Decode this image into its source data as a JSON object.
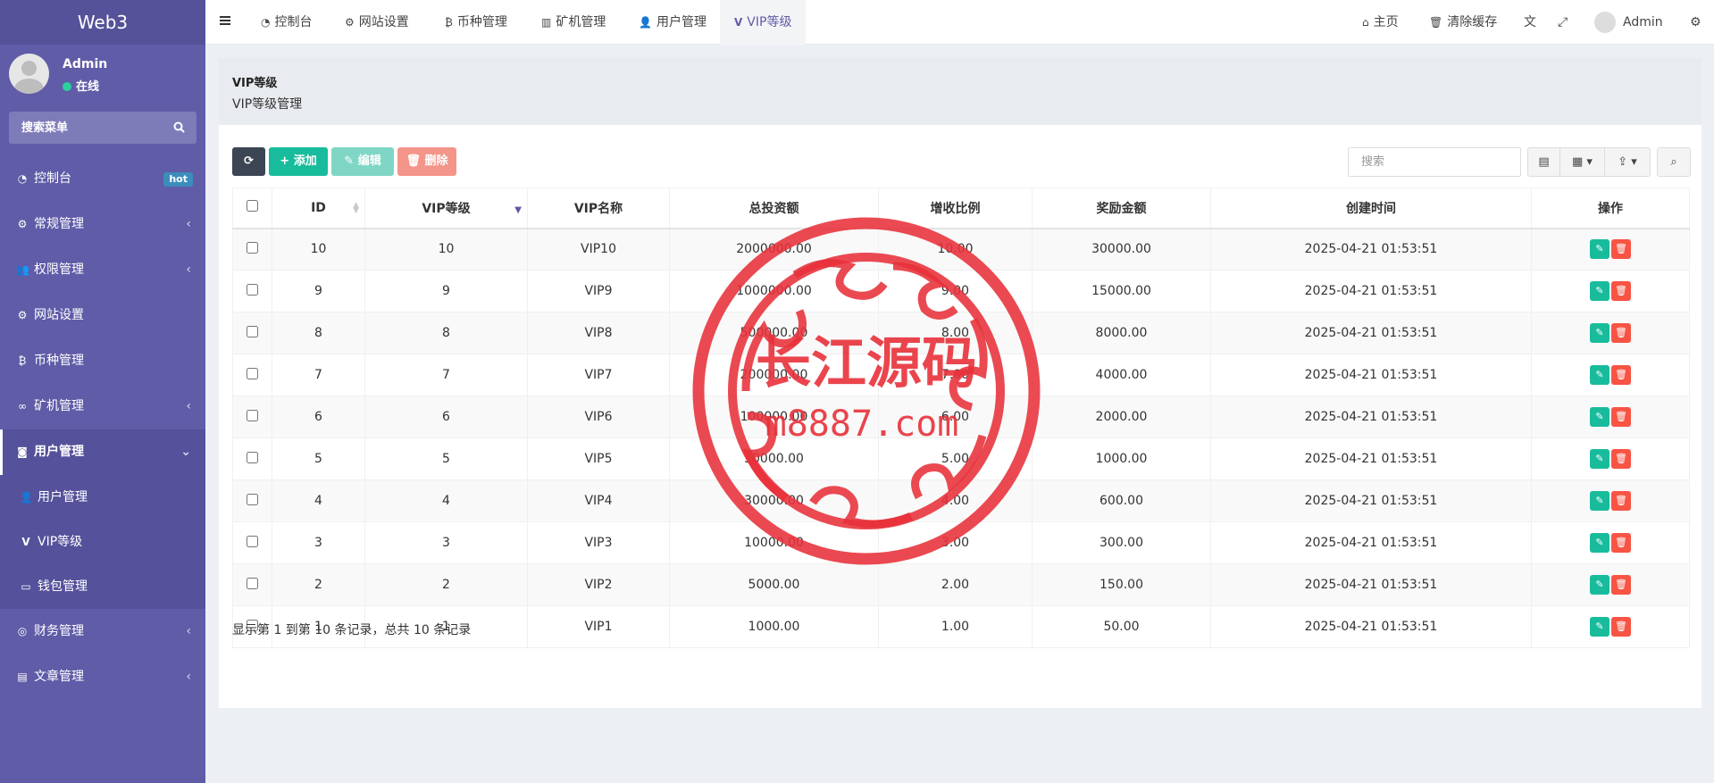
{
  "sidebar": {
    "logo": "Web3",
    "user": {
      "name": "Admin",
      "status": "在线"
    },
    "search_placeholder": "搜索菜单",
    "items": [
      {
        "label": "控制台",
        "icon": "dashboard-icon",
        "badge": "hot"
      },
      {
        "label": "常规管理",
        "icon": "cogs-icon",
        "arrow": "‹"
      },
      {
        "label": "权限管理",
        "icon": "group-icon",
        "arrow": "‹"
      },
      {
        "label": "网站设置",
        "icon": "cogs-icon"
      },
      {
        "label": "币种管理",
        "icon": "bitcoin-icon"
      },
      {
        "label": "矿机管理",
        "icon": "binoculars-icon",
        "arrow": "‹"
      },
      {
        "label": "用户管理",
        "icon": "instagram-icon",
        "arrow": "⌄"
      },
      {
        "label": "财务管理",
        "icon": "money-icon",
        "arrow": "‹"
      },
      {
        "label": "文章管理",
        "icon": "book-icon",
        "arrow": "‹"
      }
    ],
    "submenu": [
      {
        "label": "用户管理",
        "icon": "user-icon"
      },
      {
        "label": "VIP等级",
        "icon": "vimeo-icon"
      },
      {
        "label": "钱包管理",
        "icon": "credit-card-icon"
      }
    ]
  },
  "topbar": {
    "tabs": [
      {
        "label": "控制台"
      },
      {
        "label": "网站设置"
      },
      {
        "label": "币种管理"
      },
      {
        "label": "矿机管理"
      },
      {
        "label": "用户管理"
      },
      {
        "label": "VIP等级"
      }
    ],
    "home": "主页",
    "clear_cache": "清除缓存",
    "admin": "Admin"
  },
  "page": {
    "title": "VIP等级",
    "subtitle": "VIP等级管理"
  },
  "toolbar": {
    "add": "添加",
    "edit": "编辑",
    "delete": "删除",
    "search_placeholder": "搜索"
  },
  "table": {
    "headers": [
      "ID",
      "VIP等级",
      "VIP名称",
      "总投资额",
      "增收比例",
      "奖励金额",
      "创建时间",
      "操作"
    ],
    "rows": [
      [
        "10",
        "10",
        "VIP10",
        "2000000.00",
        "10.00",
        "30000.00",
        "2025-04-21 01:53:51"
      ],
      [
        "9",
        "9",
        "VIP9",
        "1000000.00",
        "9.00",
        "15000.00",
        "2025-04-21 01:53:51"
      ],
      [
        "8",
        "8",
        "VIP8",
        "500000.00",
        "8.00",
        "8000.00",
        "2025-04-21 01:53:51"
      ],
      [
        "7",
        "7",
        "VIP7",
        "200000.00",
        "7.00",
        "4000.00",
        "2025-04-21 01:53:51"
      ],
      [
        "6",
        "6",
        "VIP6",
        "100000.00",
        "6.00",
        "2000.00",
        "2025-04-21 01:53:51"
      ],
      [
        "5",
        "5",
        "VIP5",
        "50000.00",
        "5.00",
        "1000.00",
        "2025-04-21 01:53:51"
      ],
      [
        "4",
        "4",
        "VIP4",
        "30000.00",
        "4.00",
        "600.00",
        "2025-04-21 01:53:51"
      ],
      [
        "3",
        "3",
        "VIP3",
        "10000.00",
        "3.00",
        "300.00",
        "2025-04-21 01:53:51"
      ],
      [
        "2",
        "2",
        "VIP2",
        "5000.00",
        "2.00",
        "150.00",
        "2025-04-21 01:53:51"
      ],
      [
        "1",
        "1",
        "VIP1",
        "1000.00",
        "1.00",
        "50.00",
        "2025-04-21 01:53:51"
      ]
    ],
    "footer": "显示第 1 到第 10 条记录，总共 10 条记录"
  },
  "watermark": {
    "title": "长江源码",
    "domain": "m8887.com",
    "color": "#e8313a"
  },
  "colors": {
    "sidebar": "#605ca8",
    "accent_green": "#18bc9c",
    "danger": "#f75444"
  }
}
